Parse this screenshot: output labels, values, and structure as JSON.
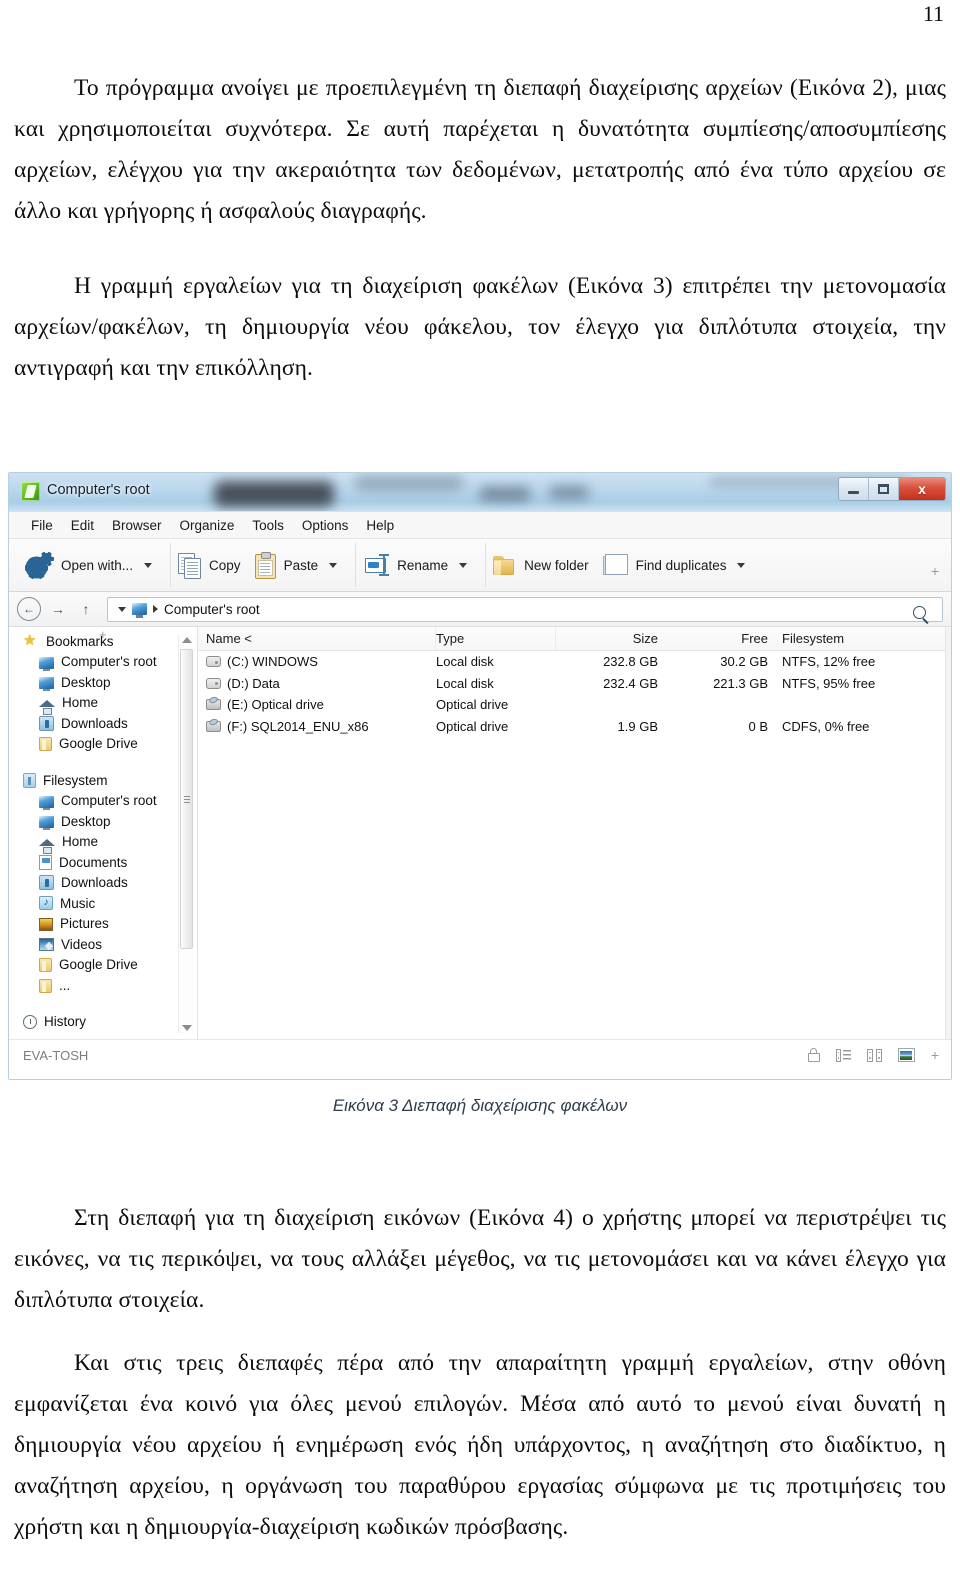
{
  "page": {
    "number": "11"
  },
  "document": {
    "paragraphs_top": [
      "Το πρόγραμμα ανοίγει με προεπιλεγμένη τη διεπαφή διαχείρισης αρχείων (Εικόνα 2), μιας και χρησιμοποιείται συχνότερα. Σε αυτή παρέχεται η δυνατότητα συμπίεσης/αποσυμπίεσης αρχείων, ελέγχου για την ακεραιότητα των δεδομένων, μετατροπής από ένα τύπο αρχείου σε άλλο και γρήγορης ή ασφαλούς διαγραφής.",
      "Η γραμμή εργαλείων για τη διαχείριση φακέλων (Εικόνα 3) επιτρέπει την μετονομασία αρχείων/φακέλων, τη δημιουργία νέου φάκελου, τον έλεγχο για διπλότυπα στοιχεία, την αντιγραφή και την επικόλληση."
    ],
    "caption": "Εικόνα 3 Διεπαφή διαχείρισης φακέλων",
    "paragraphs_bottom": [
      "Στη διεπαφή για τη διαχείριση εικόνων (Εικόνα 4) ο χρήστης μπορεί να περιστρέψει τις εικόνες, να τις περικόψει, να τους αλλάξει μέγεθος, να τις μετονομάσει και να κάνει έλεγχο για διπλότυπα στοιχεία.",
      "Και στις τρεις διεπαφές πέρα από την απαραίτητη γραμμή εργαλείων, στην οθόνη εμφανίζεται ένα κοινό για όλες μενού επιλογών. Μέσα από αυτό το μενού είναι δυνατή η δημιουργία νέου αρχείου ή ενημέρωση ενός ήδη υπάρχοντος, η αναζήτηση στο διαδίκτυο, η αναζήτηση αρχείου, η οργάνωση του παραθύρου εργασίας σύμφωνα με τις προτιμήσεις του χρήστη και η δημιουργία-διαχείριση κωδικών πρόσβασης."
    ]
  },
  "screenshot": {
    "window": {
      "title": "Computer's root",
      "controls": {
        "minimize": "—",
        "maximize": "❐",
        "close": "x"
      }
    },
    "menubar": [
      "File",
      "Edit",
      "Browser",
      "Organize",
      "Tools",
      "Options",
      "Help"
    ],
    "toolbar": {
      "buttons": [
        {
          "label": "Open with...",
          "icon": "gears-icon",
          "dropdown": true
        },
        {
          "label": "Copy",
          "icon": "copy-icon",
          "dropdown": false
        },
        {
          "label": "Paste",
          "icon": "paste-icon",
          "dropdown": true
        },
        {
          "label": "Rename",
          "icon": "rename-icon",
          "dropdown": true
        },
        {
          "label": "New folder",
          "icon": "folder-icon",
          "dropdown": false
        },
        {
          "label": "Find duplicates",
          "icon": "image-icon",
          "dropdown": true
        }
      ],
      "overflow": "+"
    },
    "addressbar": {
      "back": "←",
      "forward": "→",
      "up": "↑",
      "path": "Computer's root",
      "search_icon": "search-icon"
    },
    "sidebar": {
      "add": "+",
      "groups": [
        {
          "header": {
            "label": "Bookmarks",
            "icon": "star-icon"
          },
          "items": [
            {
              "label": "Computer's root",
              "icon": "monitor-icon"
            },
            {
              "label": "Desktop",
              "icon": "monitor-icon"
            },
            {
              "label": "Home",
              "icon": "home-icon"
            },
            {
              "label": "Downloads",
              "icon": "downloads-icon"
            },
            {
              "label": "Google Drive",
              "icon": "folder-icon"
            }
          ]
        },
        {
          "header": {
            "label": "Filesystem",
            "icon": "filesystem-icon"
          },
          "items": [
            {
              "label": "Computer's root",
              "icon": "monitor-icon"
            },
            {
              "label": "Desktop",
              "icon": "monitor-icon"
            },
            {
              "label": "Home",
              "icon": "home-icon"
            },
            {
              "label": "Documents",
              "icon": "document-icon"
            },
            {
              "label": "Downloads",
              "icon": "downloads-icon"
            },
            {
              "label": "Music",
              "icon": "music-icon"
            },
            {
              "label": "Pictures",
              "icon": "pictures-icon"
            },
            {
              "label": "Videos",
              "icon": "videos-icon"
            },
            {
              "label": "Google Drive",
              "icon": "folder-icon"
            },
            {
              "label": "...",
              "icon": "folder-icon"
            }
          ]
        },
        {
          "header": {
            "label": "History",
            "icon": "clock-icon"
          },
          "items": []
        }
      ]
    },
    "filelist": {
      "columns": [
        "Name <",
        "Type",
        "Size",
        "Free",
        "Filesystem"
      ],
      "rows": [
        {
          "icon": "hdd-icon",
          "name": "(C:) WINDOWS",
          "type": "Local disk",
          "size": "232.8 GB",
          "free": "30.2 GB",
          "filesystem": "NTFS, 12% free"
        },
        {
          "icon": "hdd-icon",
          "name": "(D:) Data",
          "type": "Local disk",
          "size": "232.4 GB",
          "free": "221.3 GB",
          "filesystem": "NTFS, 95% free"
        },
        {
          "icon": "optical-icon",
          "name": "(E:) Optical drive",
          "type": "Optical drive",
          "size": "",
          "free": "",
          "filesystem": ""
        },
        {
          "icon": "optical-icon",
          "name": "(F:) SQL2014_ENU_x86",
          "type": "Optical drive",
          "size": "1.9 GB",
          "free": "0 B",
          "filesystem": "CDFS, 0% free"
        }
      ]
    },
    "statusbar": {
      "label": "EVA-TOSH",
      "icons": [
        "lock-icon",
        "list-view-icon",
        "grid-view-icon",
        "thumbnail-view-icon"
      ],
      "plus": "+"
    }
  },
  "colors": {
    "titlebar_glass": "#bcd8ee",
    "close_button": "#d9503c",
    "accent_blue": "#2a6496",
    "folder_yellow": "#ecc467",
    "sidebar_text": "#101010"
  }
}
